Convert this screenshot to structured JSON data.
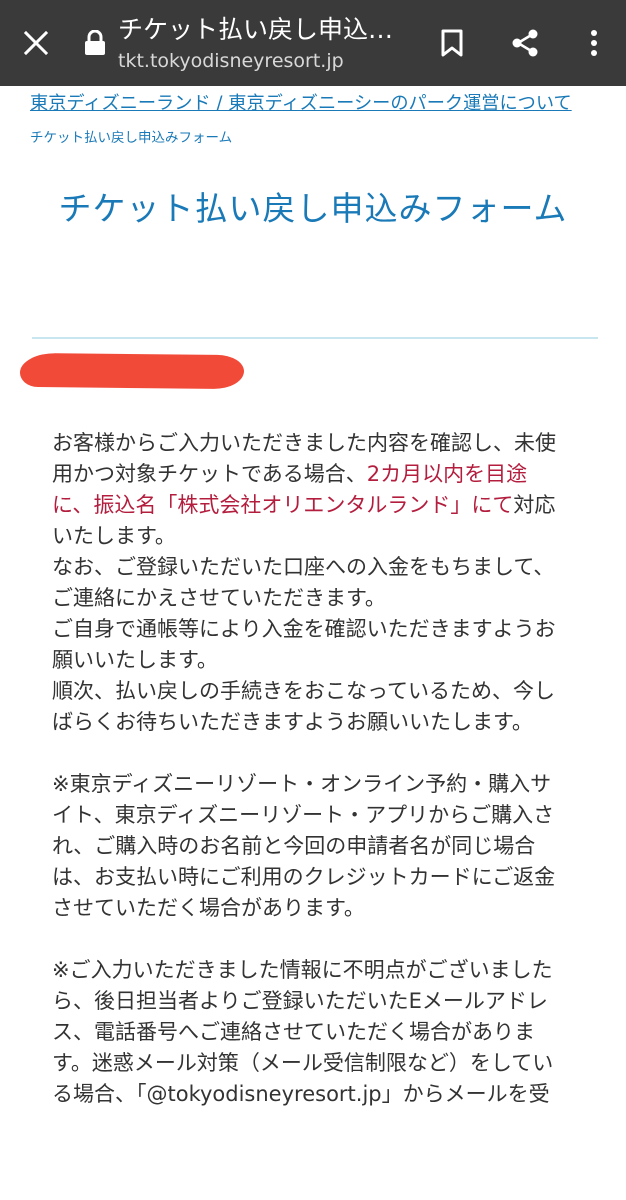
{
  "browser": {
    "title": "チケット払い戻し申込…",
    "url": "tkt.tokyodisneyresort.jp",
    "icons": {
      "close": "close-icon",
      "lock": "lock-icon",
      "bookmark": "bookmark-icon",
      "share": "share-icon",
      "menu": "more-vert-icon"
    }
  },
  "breadcrumb": {
    "link": "東京ディズニーランド / 東京ディズニーシーのパーク運営について",
    "current": "チケット払い戻し申込みフォーム"
  },
  "page": {
    "title": "チケット払い戻し申込みフォーム"
  },
  "colors": {
    "toolbar": "#3a3a3a",
    "link": "#1a7ab8",
    "highlight": "#b41e3e",
    "redaction": "#f24a38",
    "text": "#333333"
  },
  "content": {
    "p1": {
      "l1": "お客様からご入力いただきました内容を確認し、未使",
      "l2_plain": "用かつ対象チケットである場合、",
      "l2_red": "2カ月以内を目途",
      "l3_red": "に、振込名「株式会社オリエンタルランド」にて",
      "l3_plain": "対応",
      "l4": "いたします。",
      "l5": "なお、ご登録いただいた口座への入金をもちまして、",
      "l6": "ご連絡にかえさせていただきます。",
      "l7": "ご自身で通帳等により入金を確認いただきますようお",
      "l8": "願いいたします。",
      "l9": "順次、払い戻しの手続きをおこなっているため、今し",
      "l10": "ばらくお待ちいただきますようお願いいたします。"
    },
    "note1": [
      "※東京ディズニーリゾート・オンライン予約・購入サ",
      "イト、東京ディズニーリゾート・アプリからご購入さ",
      "れ、ご購入時のお名前と今回の申請者名が同じ場合",
      "は、お支払い時にご利用のクレジットカードにご返金",
      "させていただく場合があります。"
    ],
    "note2": [
      "※ご入力いただきました情報に不明点がございました",
      "ら、後日担当者よりご登録いただいたEメールアドレ",
      "ス、電話番号へご連絡させていただく場合がありま",
      "す。迷惑メール対策（メール受信制限など）をしてい",
      "る場合、「@tokyodisneyresort.jp」からメールを受"
    ]
  }
}
